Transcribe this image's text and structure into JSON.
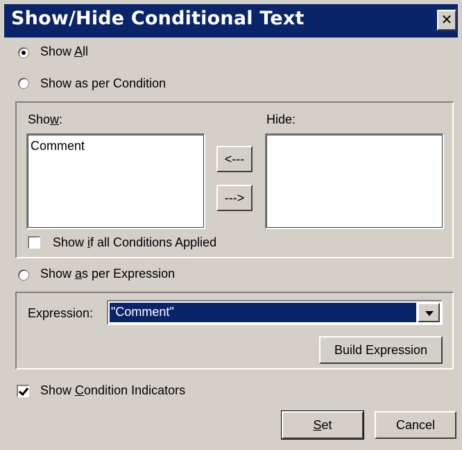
{
  "window": {
    "title": "Show/Hide Conditional Text",
    "close_glyph": "✕",
    "title_bar_color": "#0a246a",
    "face_color": "#d4d0c8"
  },
  "mode": {
    "selected": "show_all",
    "show_all_label": "Show All",
    "show_per_condition_label": "Show as per Condition",
    "show_per_expression_label": "Show as per Expression"
  },
  "conditions": {
    "show_label": "Show:",
    "hide_label": "Hide:",
    "show_items": [
      "Comment"
    ],
    "hide_items": [],
    "move_left_label": "<---",
    "move_right_label": "--->",
    "all_applied_label": "Show if all Conditions Applied",
    "all_applied_checked": false
  },
  "expression": {
    "label": "Expression:",
    "value": "\"Comment\"",
    "build_button": "Build Expression"
  },
  "indicators": {
    "label": "Show Condition Indicators",
    "checked": true
  },
  "footer": {
    "set_button": "Set",
    "cancel_button": "Cancel"
  }
}
